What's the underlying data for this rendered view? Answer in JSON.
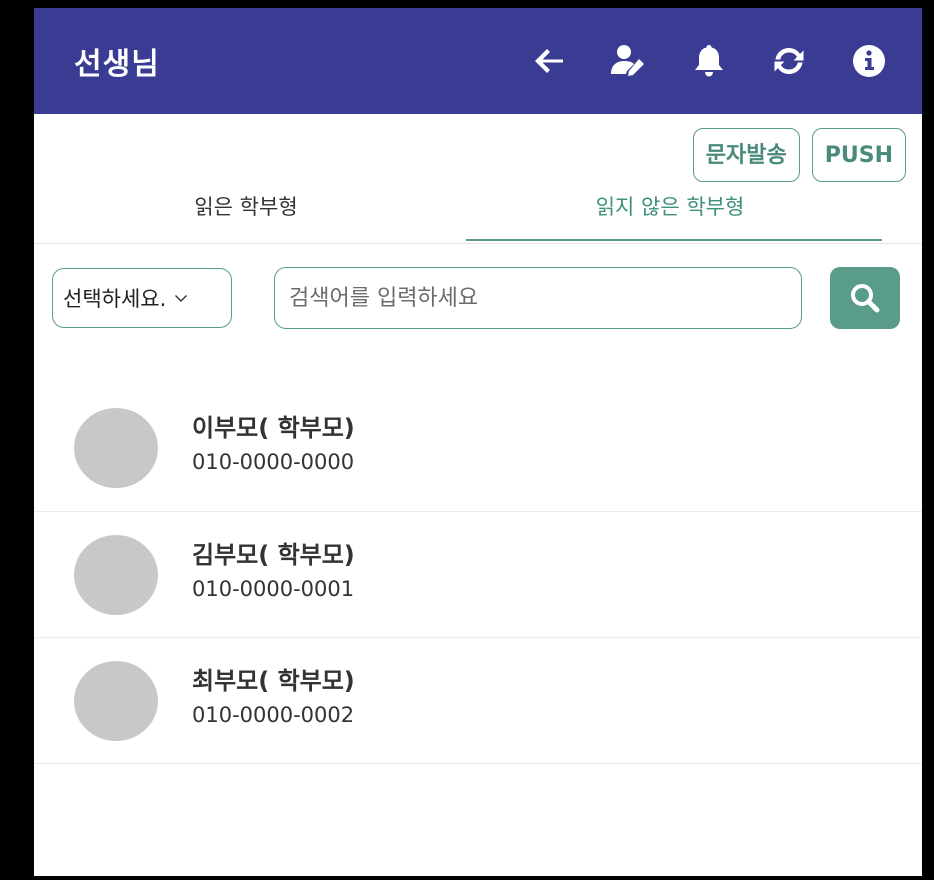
{
  "appbar": {
    "title": "선생님",
    "icons": [
      "back-arrow-icon",
      "user-edit-icon",
      "bell-icon",
      "refresh-icon",
      "info-icon"
    ],
    "background": "#3a3b92"
  },
  "actions": {
    "sms_label": "문자발송",
    "push_label": "PUSH"
  },
  "tabs": [
    {
      "label": "읽은 학부형",
      "active": false
    },
    {
      "label": "읽지 않은 학부형",
      "active": true
    }
  ],
  "search": {
    "select_value": "선택하세요.",
    "placeholder": "검색어를 입력하세요",
    "value": ""
  },
  "parents": [
    {
      "name": "이부모( 학부모)",
      "phone": "010-0000-0000"
    },
    {
      "name": "김부모( 학부모)",
      "phone": "010-0000-0001"
    },
    {
      "name": "최부모( 학부모)",
      "phone": "010-0000-0002"
    }
  ],
  "colors": {
    "accent": "#5a9c8a",
    "avatar": "#c8c8c8"
  }
}
